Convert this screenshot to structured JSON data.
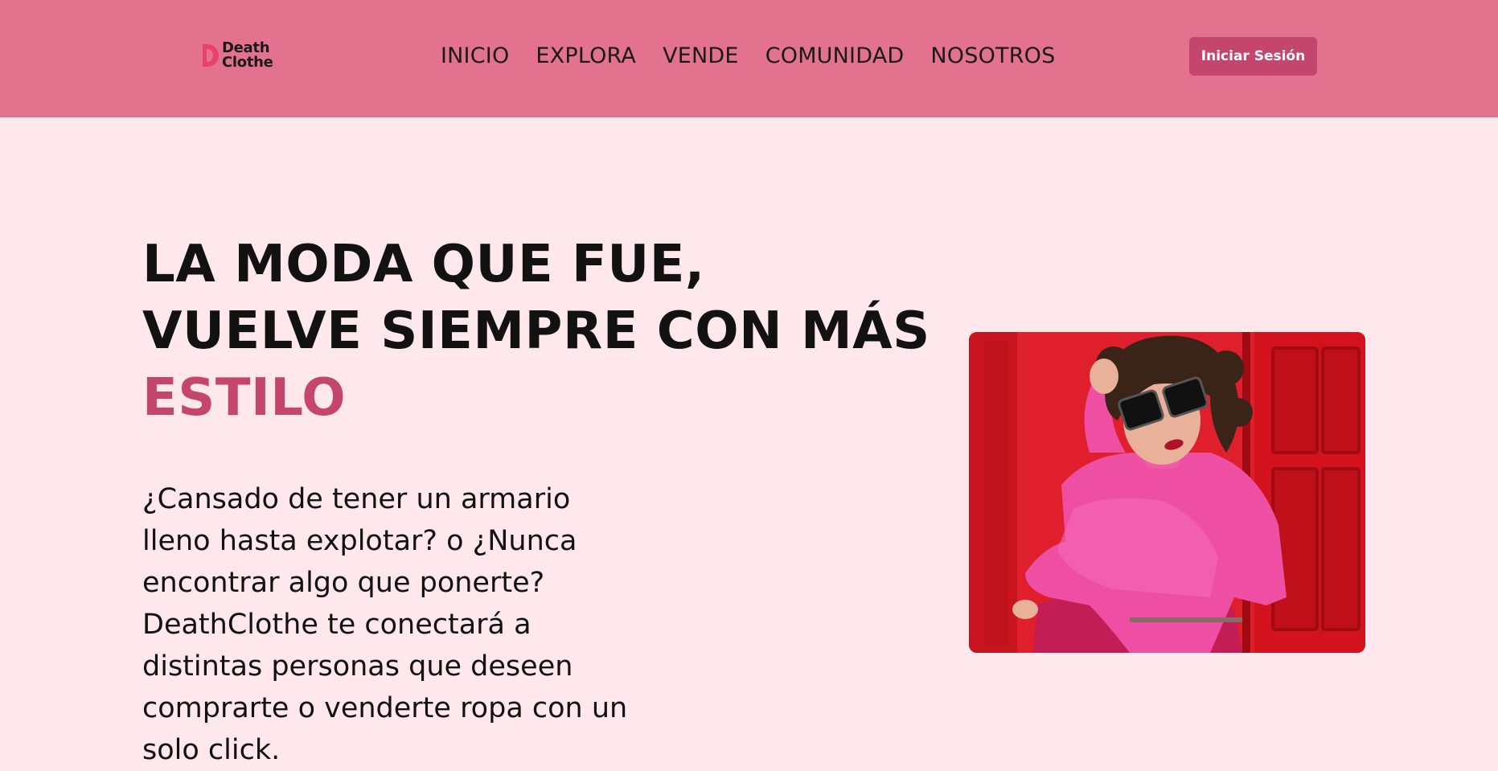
{
  "brand": {
    "name_line1": "Death",
    "name_line2": "Clothe",
    "accent_color": "#c4466d",
    "header_color": "#e3728f",
    "background_color": "#ffe8ec"
  },
  "nav": {
    "items": [
      {
        "label": "INICIO"
      },
      {
        "label": "EXPLORA"
      },
      {
        "label": "VENDE"
      },
      {
        "label": "COMUNIDAD"
      },
      {
        "label": "NOSOTROS"
      }
    ],
    "login_label": "Iniciar Sesión"
  },
  "hero": {
    "title_line1": "LA MODA QUE FUE,",
    "title_line2": "VUELVE SIEMPRE CON MÁS",
    "title_accent": "ESTILO",
    "description": "¿Cansado de tener un armario lleno hasta explotar? o ¿Nunca encontrar algo que ponerte? DeathClothe te conectará a distintas personas que deseen comprarte o venderte ropa con un solo click."
  }
}
